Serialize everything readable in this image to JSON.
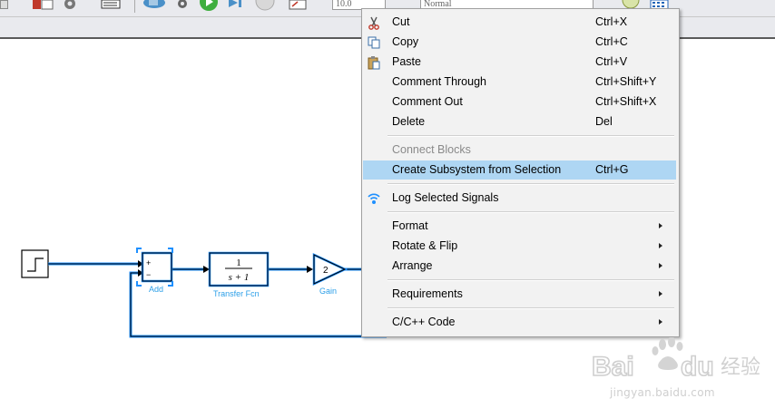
{
  "toolbar": {
    "sim_time": "10.0",
    "sim_mode": "Normal",
    "icons": [
      "library-icon",
      "settings-icon",
      "model-explorer-icon",
      "step-back-icon",
      "config-icon",
      "run-icon",
      "step-forward-icon",
      "stop-icon",
      "record-icon",
      "help-icon",
      "grid-icon"
    ]
  },
  "model": {
    "blocks": {
      "add": {
        "label": "Add",
        "plus_top": "+",
        "minus_bottom": "−"
      },
      "transfer": {
        "label": "Transfer Fcn",
        "numerator": "1",
        "denominator": "s + 1"
      },
      "gain": {
        "label": "Gain",
        "value": "2"
      }
    },
    "colors": {
      "selected_signal": "#1e90ff",
      "block_label": "#2c9fe8"
    }
  },
  "context_menu": {
    "items": [
      {
        "label": "Cut",
        "shortcut": "Ctrl+X",
        "icon": "scissors-icon"
      },
      {
        "label": "Copy",
        "shortcut": "Ctrl+C",
        "icon": "copy-icon"
      },
      {
        "label": "Paste",
        "shortcut": "Ctrl+V",
        "icon": "paste-icon"
      },
      {
        "label": "Comment Through",
        "shortcut": "Ctrl+Shift+Y"
      },
      {
        "label": "Comment Out",
        "shortcut": "Ctrl+Shift+X"
      },
      {
        "label": "Delete",
        "shortcut": "Del"
      },
      {
        "label": "Connect Blocks",
        "disabled": true
      },
      {
        "label": "Create Subsystem from Selection",
        "shortcut": "Ctrl+G",
        "highlighted": true
      },
      {
        "label": "Log Selected Signals",
        "icon": "log-signal-icon"
      },
      {
        "label": "Format",
        "submenu": true
      },
      {
        "label": "Rotate & Flip",
        "submenu": true
      },
      {
        "label": "Arrange",
        "submenu": true
      },
      {
        "label": "Requirements",
        "submenu": true
      },
      {
        "label": "C/C++ Code",
        "submenu": true
      }
    ],
    "highlight_color": "#aed6f3"
  },
  "watermark": {
    "brand": "Bai du 经验",
    "url": "jingyan.baidu.com"
  }
}
